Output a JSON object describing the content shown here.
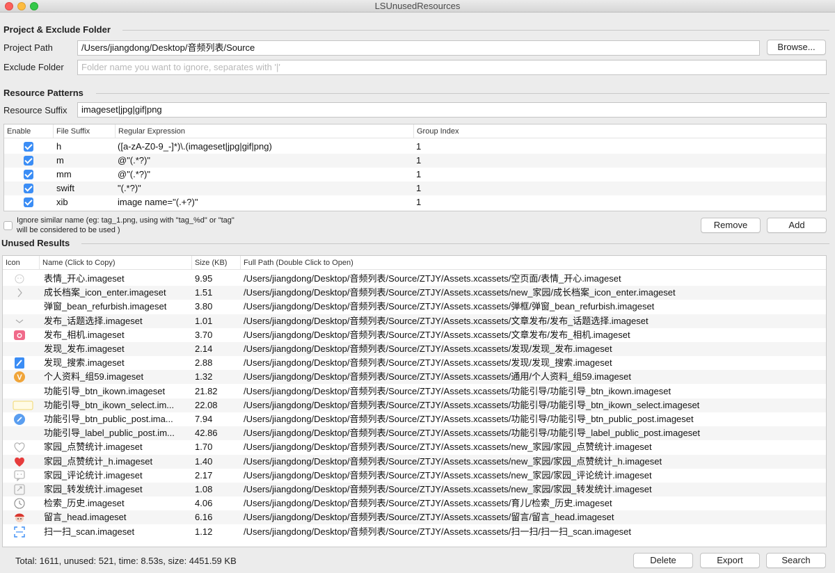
{
  "window": {
    "title": "LSUnusedResources"
  },
  "project": {
    "section_title": "Project & Exclude Folder",
    "path_label": "Project Path",
    "path_value": "/Users/jiangdong/Desktop/音频列表/Source",
    "browse_label": "Browse...",
    "exclude_label": "Exclude Folder",
    "exclude_placeholder": "Folder name you want to ignore, separates with '|'"
  },
  "patterns": {
    "section_title": "Resource Patterns",
    "suffix_label": "Resource Suffix",
    "suffix_value": "imageset|jpg|gif|png",
    "columns": [
      "Enable",
      "File Suffix",
      "Regular Expression",
      "Group Index"
    ],
    "rows": [
      {
        "enabled": true,
        "suffix": "h",
        "regex": "([a-zA-Z0-9_-]*)\\.(imageset|jpg|gif|png)",
        "group": "1"
      },
      {
        "enabled": true,
        "suffix": "m",
        "regex": "@\"(.*?)\"",
        "group": "1"
      },
      {
        "enabled": true,
        "suffix": "mm",
        "regex": "@\"(.*?)\"",
        "group": "1"
      },
      {
        "enabled": true,
        "suffix": "swift",
        "regex": "\"(.*?)\"",
        "group": "1"
      },
      {
        "enabled": true,
        "suffix": "xib",
        "regex": "image name=\"(.+?)\"",
        "group": "1"
      }
    ],
    "ignore_similar_label_line1": "Ignore similar name (eg: tag_1.png, using with \"tag_%d\" or \"tag\"",
    "ignore_similar_label_line2": "will be considered to be used )",
    "remove_label": "Remove",
    "add_label": "Add"
  },
  "results": {
    "section_title": "Unused Results",
    "columns": [
      "Icon",
      "Name (Click to Copy)",
      "Size (KB)",
      "Full Path (Double Click to Open)"
    ],
    "rows": [
      {
        "icon": "face-outline-icon",
        "name": "表情_开心.imageset",
        "size": "9.95",
        "path": "/Users/jiangdong/Desktop/音频列表/Source/ZTJY/Assets.xcassets/空页面/表情_开心.imageset"
      },
      {
        "icon": "chevron-right-icon",
        "name": "成长档案_icon_enter.imageset",
        "size": "1.51",
        "path": "/Users/jiangdong/Desktop/音频列表/Source/ZTJY/Assets.xcassets/new_家园/成长档案_icon_enter.imageset"
      },
      {
        "icon": "",
        "name": "弹窗_bean_refurbish.imageset",
        "size": "3.80",
        "path": "/Users/jiangdong/Desktop/音频列表/Source/ZTJY/Assets.xcassets/弹框/弹窗_bean_refurbish.imageset"
      },
      {
        "icon": "chevron-down-icon",
        "name": "发布_话题选择.imageset",
        "size": "1.01",
        "path": "/Users/jiangdong/Desktop/音频列表/Source/ZTJY/Assets.xcassets/文章发布/发布_话题选择.imageset"
      },
      {
        "icon": "camera-pink-icon",
        "name": "发布_相机.imageset",
        "size": "3.70",
        "path": "/Users/jiangdong/Desktop/音频列表/Source/ZTJY/Assets.xcassets/文章发布/发布_相机.imageset"
      },
      {
        "icon": "",
        "name": "发现_发布.imageset",
        "size": "2.14",
        "path": "/Users/jiangdong/Desktop/音频列表/Source/ZTJY/Assets.xcassets/发现/发现_发布.imageset"
      },
      {
        "icon": "edit-blue-icon",
        "name": "发现_搜索.imageset",
        "size": "2.88",
        "path": "/Users/jiangdong/Desktop/音频列表/Source/ZTJY/Assets.xcassets/发现/发现_搜索.imageset"
      },
      {
        "icon": "v-badge-icon",
        "name": "个人资料_组59.imageset",
        "size": "1.32",
        "path": "/Users/jiangdong/Desktop/音频列表/Source/ZTJY/Assets.xcassets/通用/个人资料_组59.imageset"
      },
      {
        "icon": "",
        "name": "功能引导_btn_ikown.imageset",
        "size": "21.82",
        "path": "/Users/jiangdong/Desktop/音频列表/Source/ZTJY/Assets.xcassets/功能引导/功能引导_btn_ikown.imageset"
      },
      {
        "icon": "button-outline-icon",
        "name": "功能引导_btn_ikown_select.im...",
        "size": "22.08",
        "path": "/Users/jiangdong/Desktop/音频列表/Source/ZTJY/Assets.xcassets/功能引导/功能引导_btn_ikown_select.imageset"
      },
      {
        "icon": "pencil-circle-icon",
        "name": "功能引导_btn_public_post.ima...",
        "size": "7.94",
        "path": "/Users/jiangdong/Desktop/音频列表/Source/ZTJY/Assets.xcassets/功能引导/功能引导_btn_public_post.imageset"
      },
      {
        "icon": "",
        "name": "功能引导_label_public_post.im...",
        "size": "42.86",
        "path": "/Users/jiangdong/Desktop/音频列表/Source/ZTJY/Assets.xcassets/功能引导/功能引导_label_public_post.imageset"
      },
      {
        "icon": "heart-outline-icon",
        "name": "家园_点赞统计.imageset",
        "size": "1.70",
        "path": "/Users/jiangdong/Desktop/音频列表/Source/ZTJY/Assets.xcassets/new_家园/家园_点赞统计.imageset"
      },
      {
        "icon": "heart-red-icon",
        "name": "家园_点赞统计_h.imageset",
        "size": "1.40",
        "path": "/Users/jiangdong/Desktop/音频列表/Source/ZTJY/Assets.xcassets/new_家园/家园_点赞统计_h.imageset"
      },
      {
        "icon": "comment-icon",
        "name": "家园_评论统计.imageset",
        "size": "2.17",
        "path": "/Users/jiangdong/Desktop/音频列表/Source/ZTJY/Assets.xcassets/new_家园/家园_评论统计.imageset"
      },
      {
        "icon": "share-icon",
        "name": "家园_转发统计.imageset",
        "size": "1.08",
        "path": "/Users/jiangdong/Desktop/音频列表/Source/ZTJY/Assets.xcassets/new_家园/家园_转发统计.imageset"
      },
      {
        "icon": "clock-icon",
        "name": "检索_历史.imageset",
        "size": "4.06",
        "path": "/Users/jiangdong/Desktop/音频列表/Source/ZTJY/Assets.xcassets/育儿/检索_历史.imageset"
      },
      {
        "icon": "avatar-red-icon",
        "name": "留言_head.imageset",
        "size": "6.16",
        "path": "/Users/jiangdong/Desktop/音频列表/Source/ZTJY/Assets.xcassets/留言/留言_head.imageset"
      },
      {
        "icon": "scan-icon",
        "name": "扫一扫_scan.imageset",
        "size": "1.12",
        "path": "/Users/jiangdong/Desktop/音频列表/Source/ZTJY/Assets.xcassets/扫一扫/扫一扫_scan.imageset"
      }
    ]
  },
  "status": {
    "summary": "Total: 1611, unused: 521, time: 8.53s, size: 4451.59 KB",
    "delete_label": "Delete",
    "export_label": "Export",
    "search_label": "Search"
  },
  "colors": {
    "checkbox_blue": "#3b8df5",
    "row_alt": "#f5f5f5"
  }
}
